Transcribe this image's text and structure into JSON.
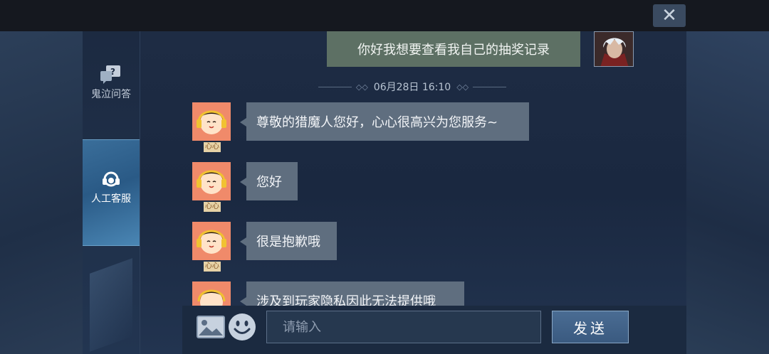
{
  "window": {
    "close_label": "✕"
  },
  "sidebar": {
    "items": [
      {
        "label": "鬼泣问答",
        "icon": "question-bubble-icon"
      },
      {
        "label": "人工客服",
        "icon": "headset-icon"
      }
    ]
  },
  "chat": {
    "user_message": "你好我想要查看我自己的抽奖记录",
    "timestamp": "06月28日 16:10",
    "agent_name": "心心",
    "messages": [
      "尊敬的猎魔人您好，心心很高兴为您服务~",
      "您好",
      "很是抱歉哦",
      "涉及到玩家隐私因此无法提供哦"
    ]
  },
  "composer": {
    "placeholder": "请输入",
    "send_label": "发送",
    "image_icon": "image-icon",
    "emoji_icon": "emoji-icon"
  },
  "colors": {
    "user_bubble": "#5d7064",
    "agent_bubble": "#5f6e7f",
    "active_tab": "#3a6e9a"
  }
}
